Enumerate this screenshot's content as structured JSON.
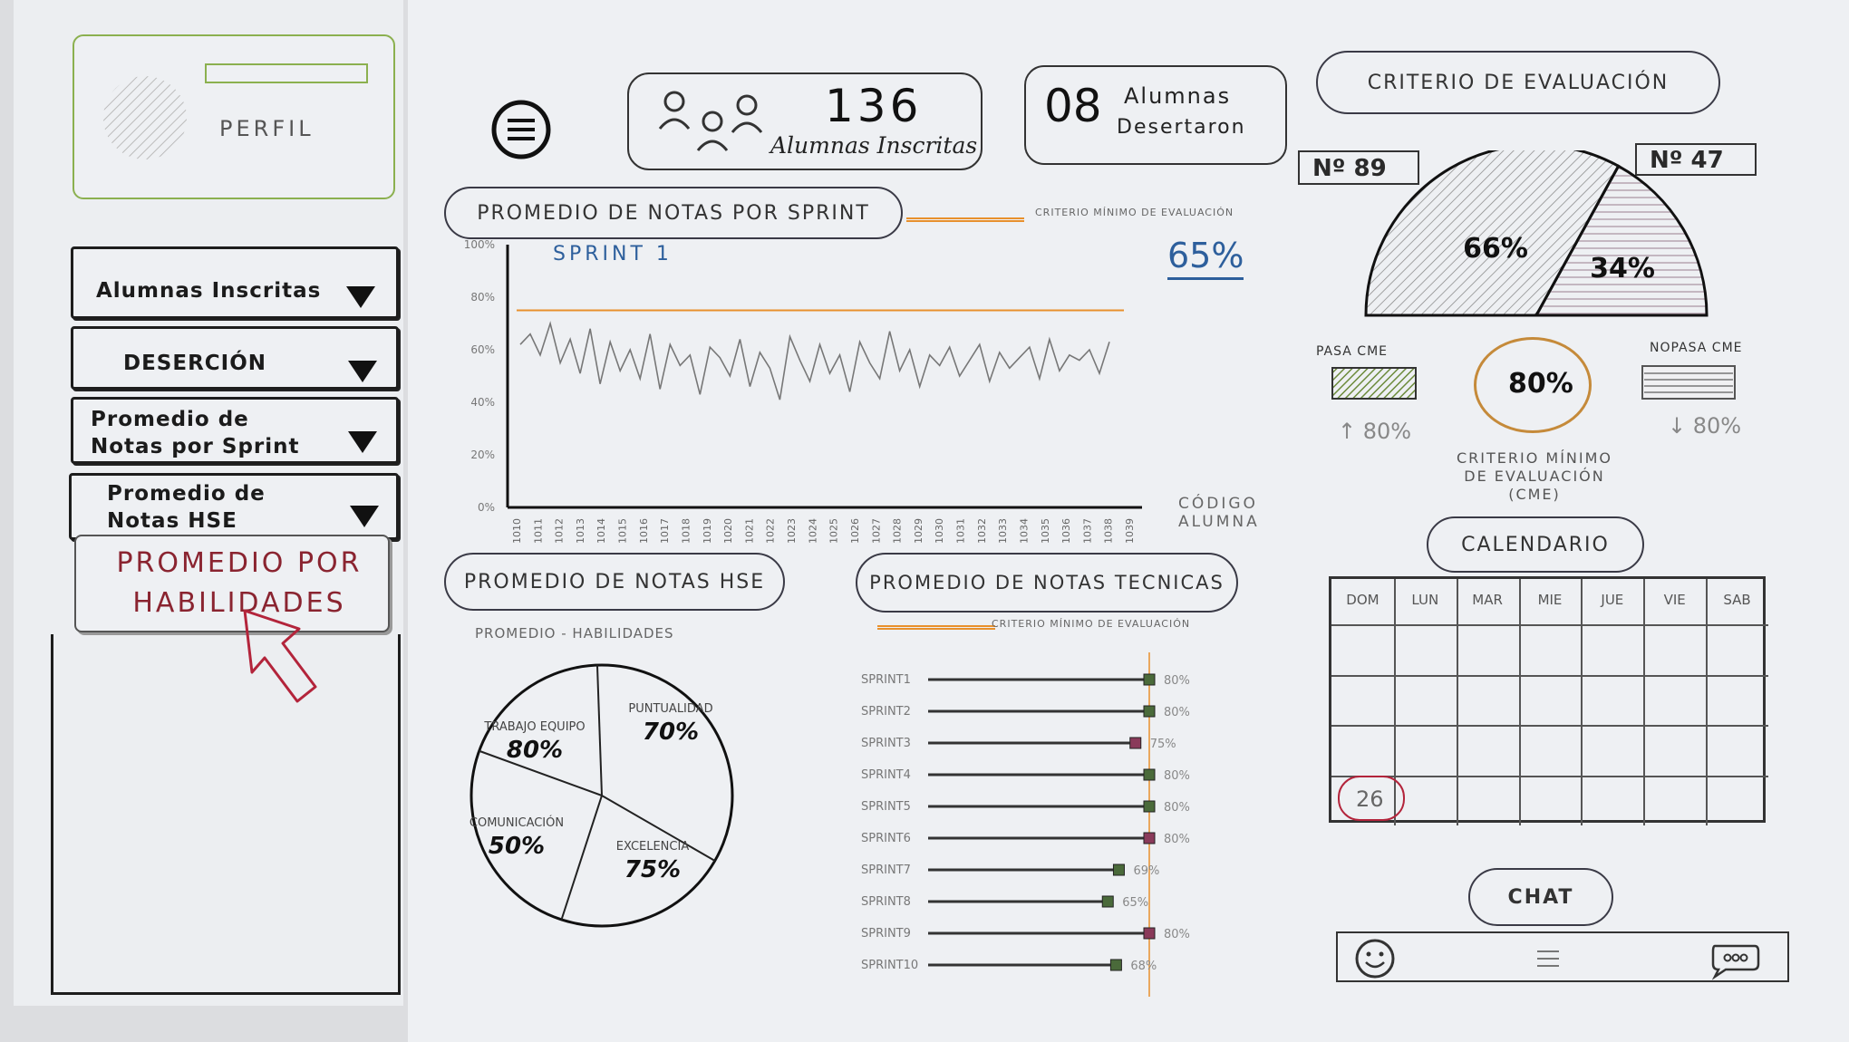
{
  "sidebar": {
    "profile_label": "PERFIL",
    "menu": [
      {
        "label": "Alumnas Inscritas"
      },
      {
        "label": "DESERCIÓN"
      },
      {
        "label": "Promedio de Notas por Sprint"
      },
      {
        "label": "Promedio de Notas HSE"
      }
    ],
    "popup_item": "PROMEDIO POR HABILIDADES"
  },
  "header": {
    "enrolled_count": "136",
    "enrolled_label": "Alumnas Inscritas",
    "dropped_count": "08",
    "dropped_label_1": "Alumnas",
    "dropped_label_2": "Desertaron"
  },
  "sprint_panel": {
    "title": "PROMEDIO DE NOTAS POR SPRINT",
    "legend": "CRITERIO MÍNIMO DE EVALUACIÓN",
    "series_label": "SPRINT 1",
    "value": "65%",
    "x_label_1": "CÓDIGO",
    "x_label_2": "ALUMNA"
  },
  "hse_panel": {
    "title": "PROMEDIO DE NOTAS HSE",
    "subtitle": "PROMEDIO - HABILIDADES"
  },
  "tech_panel": {
    "title": "PROMEDIO DE NOTAS TECNICAS",
    "legend": "CRITERIO MÍNIMO DE EVALUACIÓN"
  },
  "criteria_panel": {
    "title": "CRITERIO DE EVALUACIÓN",
    "left_badge": "Nº 89",
    "right_badge": "Nº 47",
    "pass_label": "PASA CME",
    "nopass_label": "NOPASA CME",
    "pass_trend": "↑ 80%",
    "nopass_trend": "↓ 80%",
    "center_value": "80%",
    "center_caption_1": "CRITERIO MÍNIMO",
    "center_caption_2": "DE EVALUACIÓN",
    "center_caption_3": "(CME)"
  },
  "calendar": {
    "title": "CALENDARIO",
    "days": [
      "DOM",
      "LUN",
      "MAR",
      "MIE",
      "JUE",
      "VIE",
      "SAB"
    ],
    "highlight_day": "26"
  },
  "chat": {
    "label": "CHAT"
  },
  "colors": {
    "threshold": "#e8902c",
    "accent_blue": "#2d5f9c",
    "pass_fill": "#8aa85a",
    "ink": "#2a2a2a",
    "arrow": "#b3243b"
  },
  "chart_data": [
    {
      "type": "line",
      "title": "PROMEDIO DE NOTAS POR SPRINT",
      "series_label": "SPRINT 1",
      "xlabel": "CÓDIGO ALUMNA",
      "ylabel": "",
      "y_ticks": [
        "0%",
        "20%",
        "40%",
        "60%",
        "80%",
        "100%"
      ],
      "x_ticks": [
        "1010",
        "1011",
        "1012",
        "1013",
        "1014",
        "1015",
        "1016",
        "1017",
        "1018",
        "1019",
        "1020",
        "1021",
        "1022",
        "1023",
        "1024",
        "1025",
        "1026",
        "1027",
        "1028",
        "1029",
        "1030",
        "1031",
        "1032",
        "1033",
        "1034",
        "1035",
        "1036",
        "1037",
        "1038",
        "1039"
      ],
      "ylim": [
        0,
        100
      ],
      "threshold": 75,
      "values": [
        62,
        66,
        58,
        70,
        55,
        64,
        51,
        68,
        47,
        63,
        52,
        60,
        49,
        66,
        45,
        62,
        54,
        58,
        43,
        61,
        57,
        50,
        64,
        46,
        59,
        53,
        41,
        65,
        56,
        48,
        62,
        51,
        58,
        44,
        63,
        55,
        49,
        67,
        52,
        60,
        46,
        58,
        54,
        61,
        50,
        56,
        62,
        48,
        59,
        53,
        57,
        61,
        49,
        64,
        52,
        58,
        56,
        60,
        51,
        63
      ]
    },
    {
      "type": "pie",
      "title": "PROMEDIO - HABILIDADES",
      "slices": [
        {
          "label": "PUNTUALIDAD",
          "value": "70%"
        },
        {
          "label": "EXCELENCIA",
          "value": "75%"
        },
        {
          "label": "COMUNICACIÓN",
          "value": "50%"
        },
        {
          "label": "TRABAJO EQUIPO",
          "value": "80%"
        }
      ]
    },
    {
      "type": "bar",
      "title": "PROMEDIO DE NOTAS TECNICAS",
      "orientation": "horizontal",
      "threshold": 80,
      "categories": [
        "SPRINT1",
        "SPRINT2",
        "SPRINT3",
        "SPRINT4",
        "SPRINT5",
        "SPRINT6",
        "SPRINT7",
        "SPRINT8",
        "SPRINT9",
        "SPRINT10"
      ],
      "values": [
        80,
        80,
        75,
        80,
        80,
        80,
        69,
        65,
        80,
        68
      ],
      "value_labels": [
        "80%",
        "80%",
        "75%",
        "80%",
        "80%",
        "80%",
        "69%",
        "65%",
        "80%",
        "68%"
      ]
    },
    {
      "type": "pie",
      "title": "CRITERIO DE EVALUACIÓN",
      "shape": "semicircle",
      "slices": [
        {
          "label": "PASA CME",
          "value": "66%"
        },
        {
          "label": "NOPASA CME",
          "value": "34%"
        }
      ]
    }
  ]
}
